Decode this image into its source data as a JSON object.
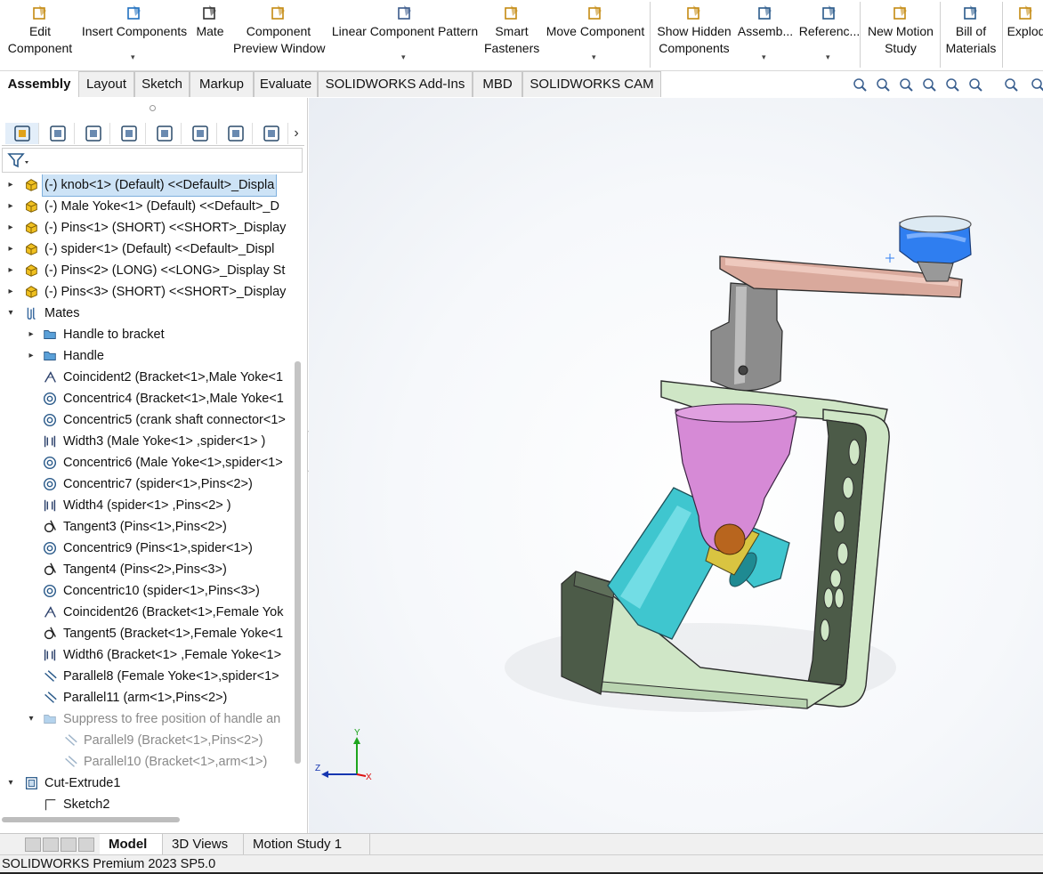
{
  "ribbon": {
    "buttons": [
      {
        "name": "edit-component-button",
        "lines": [
          "Edit",
          "Component"
        ],
        "icon": "edit-component-icon",
        "dropdown": false
      },
      {
        "name": "insert-components-button",
        "lines": [
          "Insert Components",
          ""
        ],
        "icon": "insert-components-icon",
        "dropdown": true
      },
      {
        "name": "mate-button",
        "lines": [
          "Mate",
          ""
        ],
        "icon": "mate-paperclip-icon",
        "dropdown": false
      },
      {
        "name": "component-preview-window-button",
        "lines": [
          "Component",
          "Preview Window"
        ],
        "icon": "preview-window-icon",
        "dropdown": false
      },
      {
        "name": "linear-component-pattern-button",
        "lines": [
          "Linear Component Pattern",
          ""
        ],
        "icon": "linear-pattern-icon",
        "dropdown": true
      },
      {
        "name": "smart-fasteners-button",
        "lines": [
          "Smart",
          "Fasteners"
        ],
        "icon": "smart-fasteners-icon",
        "dropdown": false
      },
      {
        "name": "move-component-button",
        "lines": [
          "Move Component",
          ""
        ],
        "icon": "move-component-icon",
        "dropdown": true
      },
      {
        "name": "show-hidden-components-button",
        "lines": [
          "Show Hidden",
          "Components"
        ],
        "icon": "show-hidden-icon",
        "dropdown": false
      },
      {
        "name": "assembly-features-button",
        "lines": [
          "Assemb...",
          ""
        ],
        "icon": "assembly-features-icon",
        "dropdown": true
      },
      {
        "name": "reference-geometry-button",
        "lines": [
          "Referenc...",
          ""
        ],
        "icon": "reference-geometry-icon",
        "dropdown": true
      },
      {
        "name": "new-motion-study-button",
        "lines": [
          "New Motion",
          "Study"
        ],
        "icon": "motion-study-icon",
        "dropdown": false
      },
      {
        "name": "bill-of-materials-button",
        "lines": [
          "Bill of",
          "Materials"
        ],
        "icon": "bill-of-materials-icon",
        "dropdown": false
      },
      {
        "name": "exploded-view-button",
        "lines": [
          "Explod",
          ""
        ],
        "icon": "exploded-view-icon",
        "dropdown": false
      }
    ]
  },
  "tabs": [
    "Assembly",
    "Layout",
    "Sketch",
    "Markup",
    "Evaluate",
    "SOLIDWORKS Add-Ins",
    "MBD",
    "SOLIDWORKS CAM"
  ],
  "active_tab": "Assembly",
  "view_toolbar": [
    "zoom-to-fit-icon",
    "zoom-to-area-icon",
    "previous-view-icon",
    "section-view-icon",
    "dynamic-annotation-icon",
    "view-orientation-icon",
    "display-style-icon",
    "hide-show-icon"
  ],
  "feature_tree": {
    "pane_tabs": [
      "featuremanager-icon",
      "propertymanager-icon",
      "configurationmanager-icon",
      "dimxpert-icon",
      "display-manager-icon",
      "cam-feature-icon",
      "cam-operation-icon",
      "cam-tools-icon"
    ],
    "rows": [
      {
        "text": "(-) knob<1> (Default) <<Default>_Displa",
        "level": 0,
        "arrow": "▸",
        "icon": "component-icon",
        "selected": true
      },
      {
        "text": "(-) Male Yoke<1> (Default) <<Default>_D",
        "level": 0,
        "arrow": "▸",
        "icon": "component-icon"
      },
      {
        "text": "(-) Pins<1> (SHORT) <<SHORT>_Display",
        "level": 0,
        "arrow": "▸",
        "icon": "component-icon"
      },
      {
        "text": "(-) spider<1> (Default) <<Default>_Displ",
        "level": 0,
        "arrow": "▸",
        "icon": "component-icon"
      },
      {
        "text": "(-) Pins<2> (LONG) <<LONG>_Display St",
        "level": 0,
        "arrow": "▸",
        "icon": "component-icon"
      },
      {
        "text": "(-) Pins<3> (SHORT) <<SHORT>_Display",
        "level": 0,
        "arrow": "▸",
        "icon": "component-icon"
      },
      {
        "text": "Mates",
        "level": 0,
        "arrow": "▾",
        "icon": "mates-icon"
      },
      {
        "text": "Handle to bracket",
        "level": 1,
        "arrow": "▸",
        "icon": "folder-icon"
      },
      {
        "text": "Handle",
        "level": 1,
        "arrow": "▸",
        "icon": "folder-icon"
      },
      {
        "text": "Coincident2 (Bracket<1>,Male Yoke<1",
        "level": 1,
        "arrow": "",
        "icon": "coincident-icon"
      },
      {
        "text": "Concentric4 (Bracket<1>,Male Yoke<1",
        "level": 1,
        "arrow": "",
        "icon": "concentric-icon"
      },
      {
        "text": "Concentric5 (crank shaft connector<1>",
        "level": 1,
        "arrow": "",
        "icon": "concentric-icon"
      },
      {
        "text": "Width3 (Male Yoke<1> ,spider<1> )",
        "level": 1,
        "arrow": "",
        "icon": "width-icon"
      },
      {
        "text": "Concentric6 (Male Yoke<1>,spider<1>",
        "level": 1,
        "arrow": "",
        "icon": "concentric-icon"
      },
      {
        "text": "Concentric7 (spider<1>,Pins<2>)",
        "level": 1,
        "arrow": "",
        "icon": "concentric-icon"
      },
      {
        "text": "Width4 (spider<1> ,Pins<2> )",
        "level": 1,
        "arrow": "",
        "icon": "width-icon"
      },
      {
        "text": "Tangent3 (Pins<1>,Pins<2>)",
        "level": 1,
        "arrow": "",
        "icon": "tangent-icon"
      },
      {
        "text": "Concentric9 (Pins<1>,spider<1>)",
        "level": 1,
        "arrow": "",
        "icon": "concentric-icon"
      },
      {
        "text": "Tangent4 (Pins<2>,Pins<3>)",
        "level": 1,
        "arrow": "",
        "icon": "tangent-icon"
      },
      {
        "text": "Concentric10 (spider<1>,Pins<3>)",
        "level": 1,
        "arrow": "",
        "icon": "concentric-icon"
      },
      {
        "text": "Coincident26 (Bracket<1>,Female Yok",
        "level": 1,
        "arrow": "",
        "icon": "coincident-icon"
      },
      {
        "text": "Tangent5 (Bracket<1>,Female Yoke<1",
        "level": 1,
        "arrow": "",
        "icon": "tangent-icon"
      },
      {
        "text": "Width6 (Bracket<1> ,Female Yoke<1>",
        "level": 1,
        "arrow": "",
        "icon": "width-icon"
      },
      {
        "text": "Parallel8 (Female Yoke<1>,spider<1>",
        "level": 1,
        "arrow": "",
        "icon": "parallel-icon"
      },
      {
        "text": "Parallel11 (arm<1>,Pins<2>)",
        "level": 1,
        "arrow": "",
        "icon": "parallel-icon"
      },
      {
        "text": "Suppress to free position of handle an",
        "level": 1,
        "arrow": "▾",
        "icon": "folder-icon",
        "dim": true
      },
      {
        "text": "Parallel9 (Bracket<1>,Pins<2>)",
        "level": 2,
        "arrow": "",
        "icon": "parallel-icon",
        "dim": true
      },
      {
        "text": "Parallel10 (Bracket<1>,arm<1>)",
        "level": 2,
        "arrow": "",
        "icon": "parallel-icon",
        "dim": true
      },
      {
        "text": "Cut-Extrude1",
        "level": 0,
        "arrow": "▾",
        "icon": "cut-extrude-icon"
      },
      {
        "text": "Sketch2",
        "level": 1,
        "arrow": "",
        "icon": "sketch-icon"
      }
    ]
  },
  "triad": {
    "x": "X",
    "y": "Y",
    "z": "Z"
  },
  "bottom_tabs": [
    "Model",
    "3D Views",
    "Motion Study 1"
  ],
  "active_bottom_tab": "Model",
  "status": "SOLIDWORKS Premium 2023 SP5.0",
  "colors": {
    "selection": "#cde3f6",
    "bracket": "#cfe6c6",
    "bracket_dark": "#4c5b48",
    "female_yoke": "#3fc6cf",
    "male_yoke": "#d68ad6",
    "shaft": "#8c8c8c",
    "arm": "#d9a99c",
    "knob": "#2f7ef0"
  }
}
